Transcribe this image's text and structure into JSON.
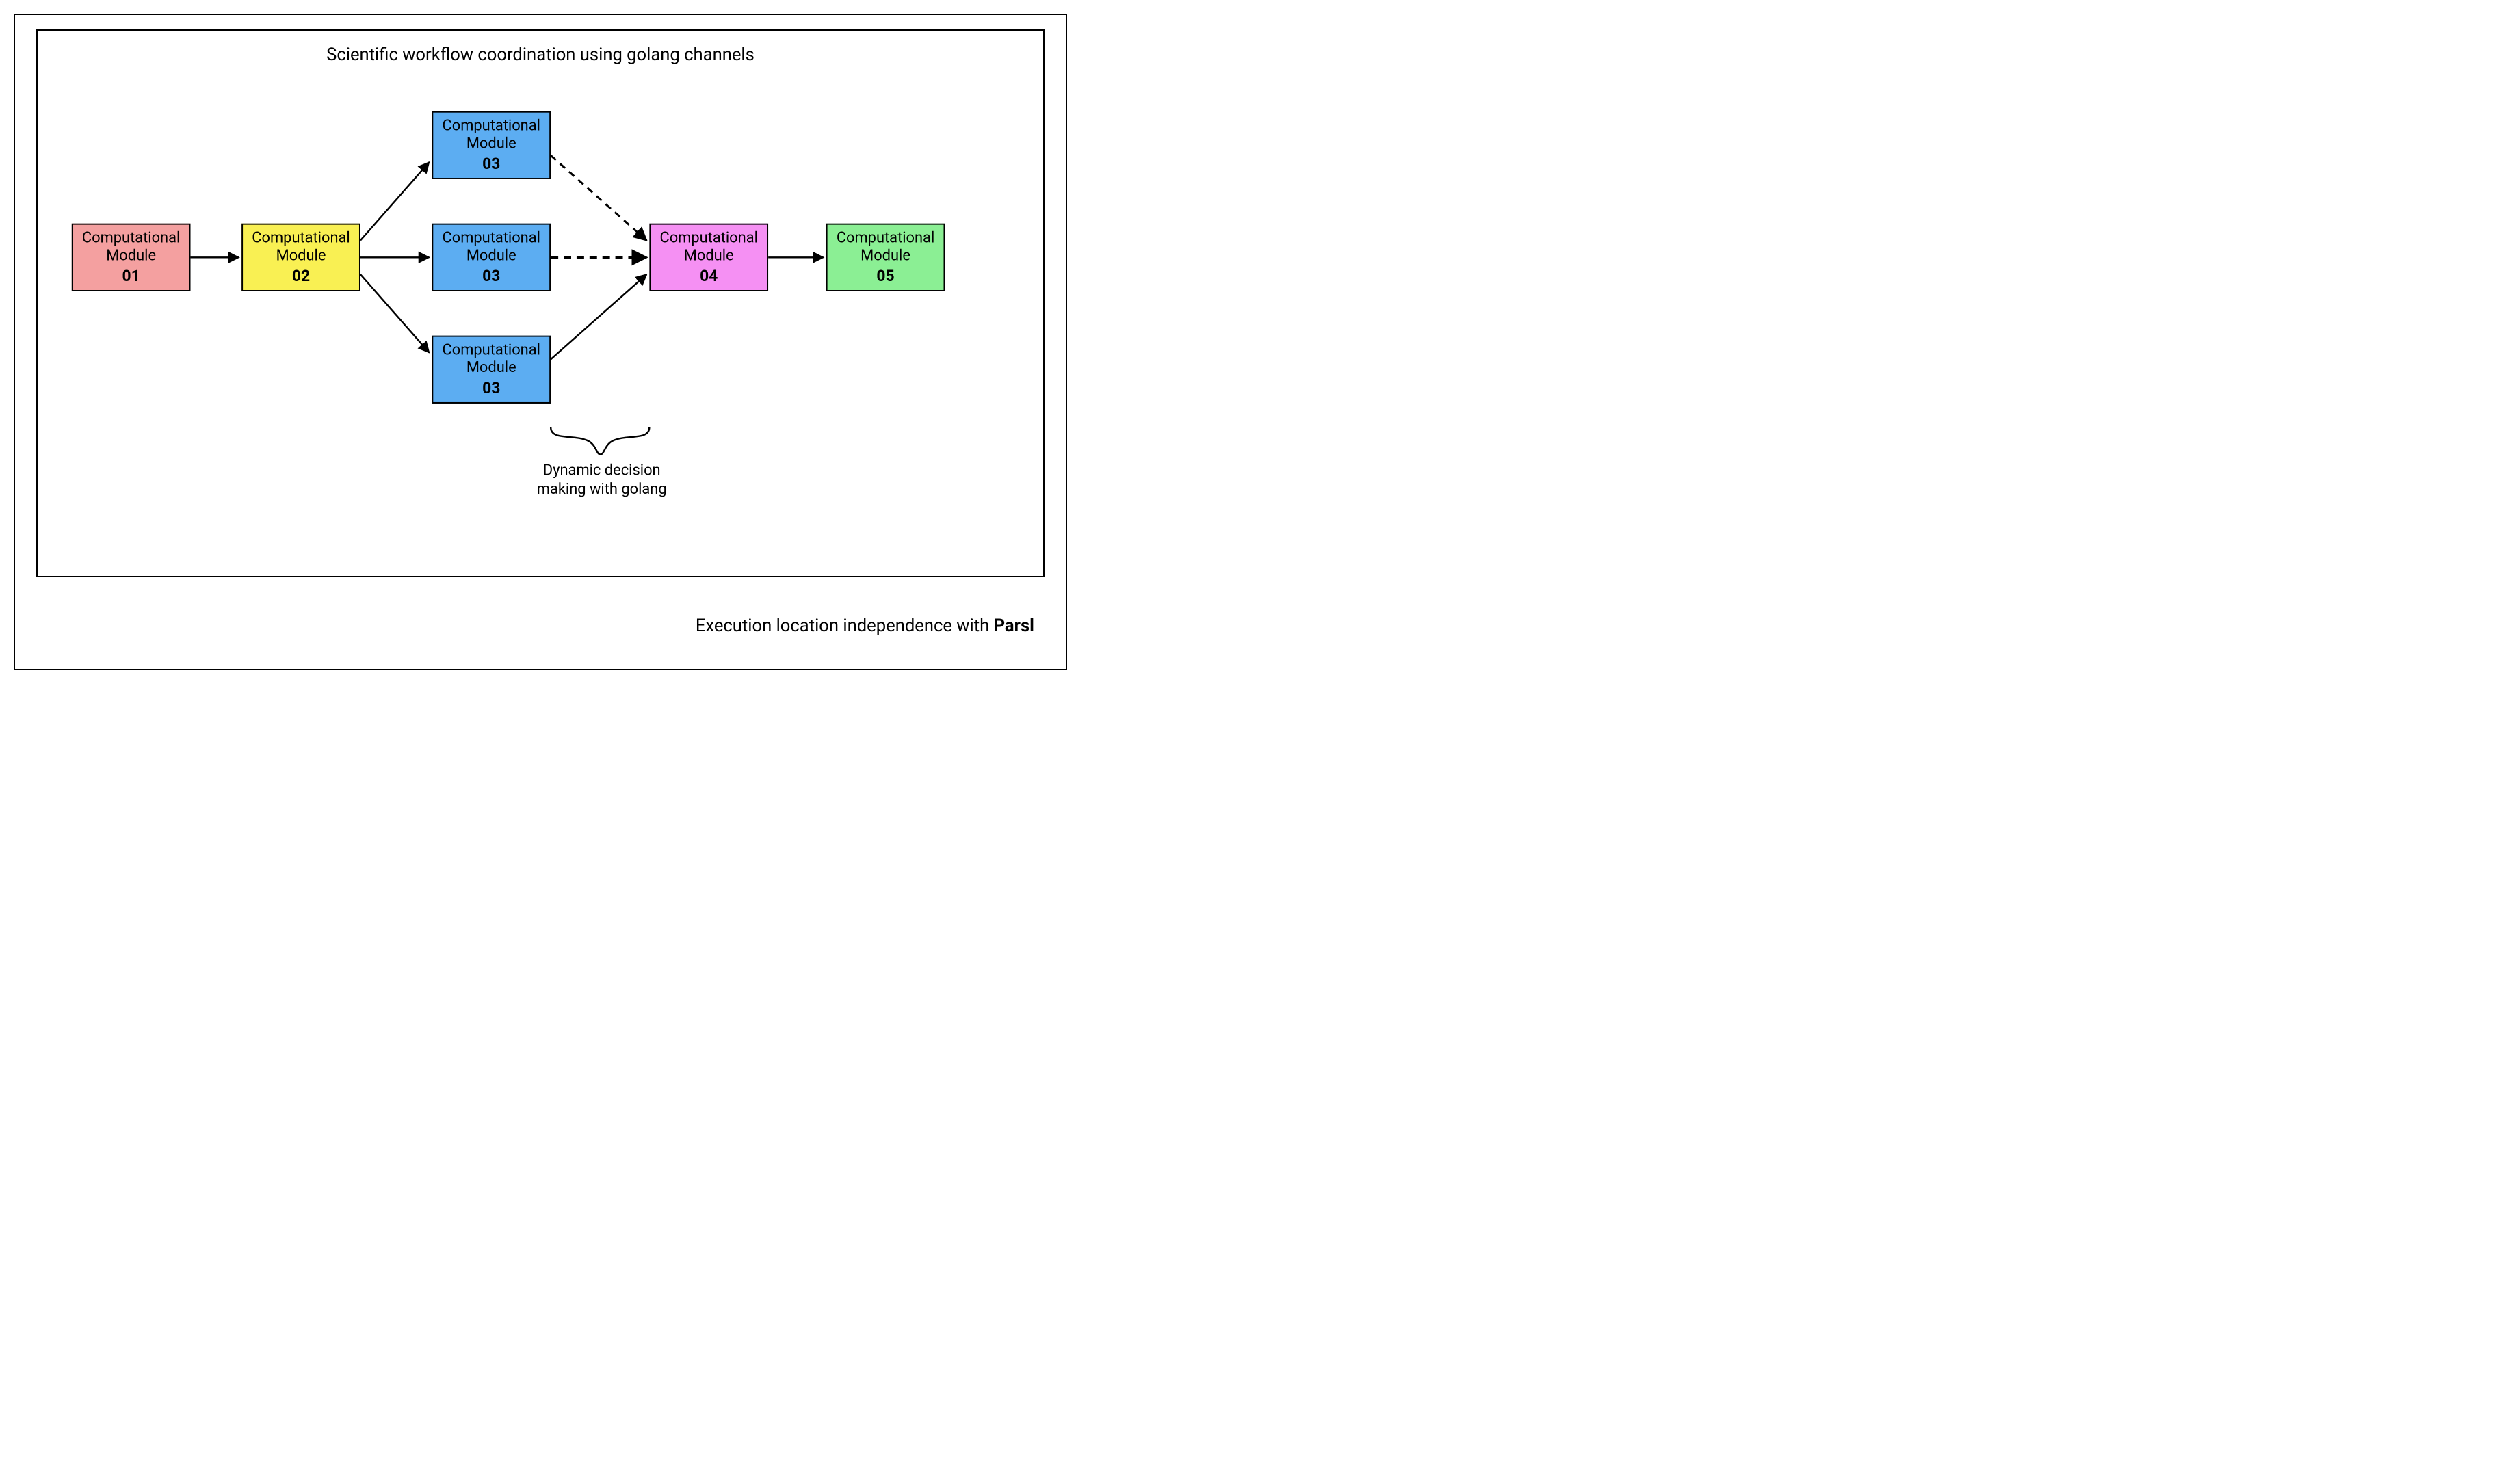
{
  "titles": {
    "inner": "Scientific workflow coordination using golang channels",
    "bottom_prefix": "Execution location independence with ",
    "bottom_bold": "Parsl"
  },
  "modules": {
    "m1": {
      "label": "Computational Module",
      "num": "01"
    },
    "m2": {
      "label": "Computational Module",
      "num": "02"
    },
    "m3a": {
      "label": "Computational Module",
      "num": "03"
    },
    "m3b": {
      "label": "Computational Module",
      "num": "03"
    },
    "m3c": {
      "label": "Computational Module",
      "num": "03"
    },
    "m4": {
      "label": "Computational Module",
      "num": "04"
    },
    "m5": {
      "label": "Computational Module",
      "num": "05"
    }
  },
  "annotation": {
    "line1": "Dynamic decision",
    "line2": "making with golang"
  },
  "colors": {
    "m1": "#f4a0a0",
    "m2": "#f9f053",
    "m3": "#5cadf2",
    "m4": "#f590f3",
    "m5": "#8bef94"
  }
}
